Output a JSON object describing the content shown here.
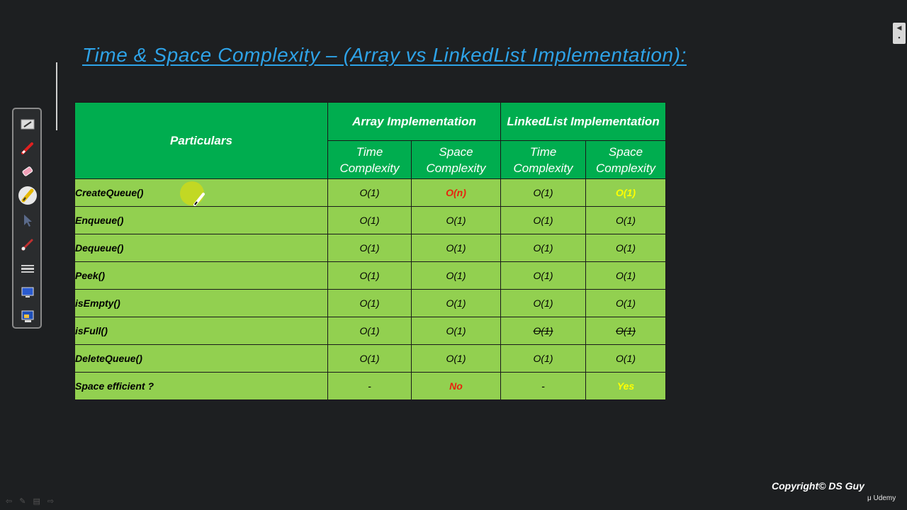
{
  "slide": {
    "title": "Time & Space Complexity – (Array vs LinkedList Implementation):",
    "copyright": "Copyright© DS Guy",
    "brand": "Udemy"
  },
  "table": {
    "header_particulars": "Particulars",
    "group_array": "Array Implementation",
    "group_linked": "LinkedList Implementation",
    "sub_time": "Time Complexity",
    "sub_space": "Space Complexity",
    "rows": [
      {
        "name": "CreateQueue()",
        "c1": "O(1)",
        "c2": "O(n)",
        "c3": "O(1)",
        "c4": "O(1)"
      },
      {
        "name": "Enqueue()",
        "c1": "O(1)",
        "c2": "O(1)",
        "c3": "O(1)",
        "c4": "O(1)"
      },
      {
        "name": "Dequeue()",
        "c1": "O(1)",
        "c2": "O(1)",
        "c3": "O(1)",
        "c4": "O(1)"
      },
      {
        "name": "Peek()",
        "c1": "O(1)",
        "c2": "O(1)",
        "c3": "O(1)",
        "c4": "O(1)"
      },
      {
        "name": "isEmpty()",
        "c1": "O(1)",
        "c2": "O(1)",
        "c3": "O(1)",
        "c4": "O(1)"
      },
      {
        "name": "isFull()",
        "c1": "O(1)",
        "c2": "O(1)",
        "c3": "O(1)",
        "c4": "O(1)"
      },
      {
        "name": "DeleteQueue()",
        "c1": "O(1)",
        "c2": "O(1)",
        "c3": "O(1)",
        "c4": "O(1)"
      },
      {
        "name": "Space efficient ?",
        "c1": "-",
        "c2": "No",
        "c3": "-",
        "c4": "Yes"
      }
    ]
  },
  "colors": {
    "header_green": "#00ad4f",
    "cell_green": "#92d050",
    "title_blue": "#2ea3e8",
    "highlight_red": "#e8230e",
    "highlight_yellow": "#ffff00"
  },
  "toolbar": {
    "tools": [
      "whiteboard-icon",
      "pen-icon",
      "eraser-icon",
      "highlighter-icon",
      "pointer-icon",
      "brush-icon",
      "line-thickness-icon",
      "screen-icon",
      "display-settings-icon"
    ]
  }
}
